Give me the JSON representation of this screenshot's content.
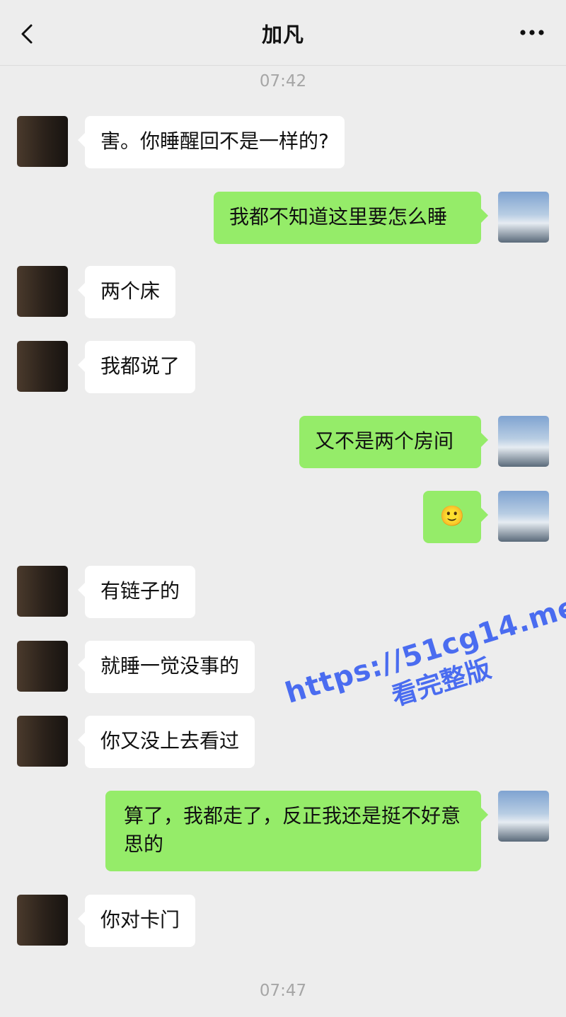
{
  "header": {
    "title": "加凡"
  },
  "timestamps": [
    "07:42",
    "07:47"
  ],
  "messages": [
    {
      "side": "in",
      "text": "害。你睡醒回不是一样的?"
    },
    {
      "side": "out",
      "text": "我都不知道这里要怎么睡"
    },
    {
      "side": "in",
      "text": "两个床"
    },
    {
      "side": "in",
      "text": "我都说了"
    },
    {
      "side": "out",
      "text": "又不是两个房间"
    },
    {
      "side": "out",
      "text": "🙂"
    },
    {
      "side": "in",
      "text": "有链子的"
    },
    {
      "side": "in",
      "text": "就睡一觉没事的"
    },
    {
      "side": "in",
      "text": "你又没上去看过"
    },
    {
      "side": "out",
      "text": "算了，我都走了，反正我还是挺不好意思的"
    },
    {
      "side": "in",
      "text": "你对卡门"
    }
  ],
  "watermark": {
    "line1": "https://51cg14.me",
    "line2": "看完整版"
  },
  "colors": {
    "background": "#ededed",
    "outgoing_bubble": "#95ec69",
    "incoming_bubble": "#ffffff",
    "watermark": "#4a6cf0"
  }
}
